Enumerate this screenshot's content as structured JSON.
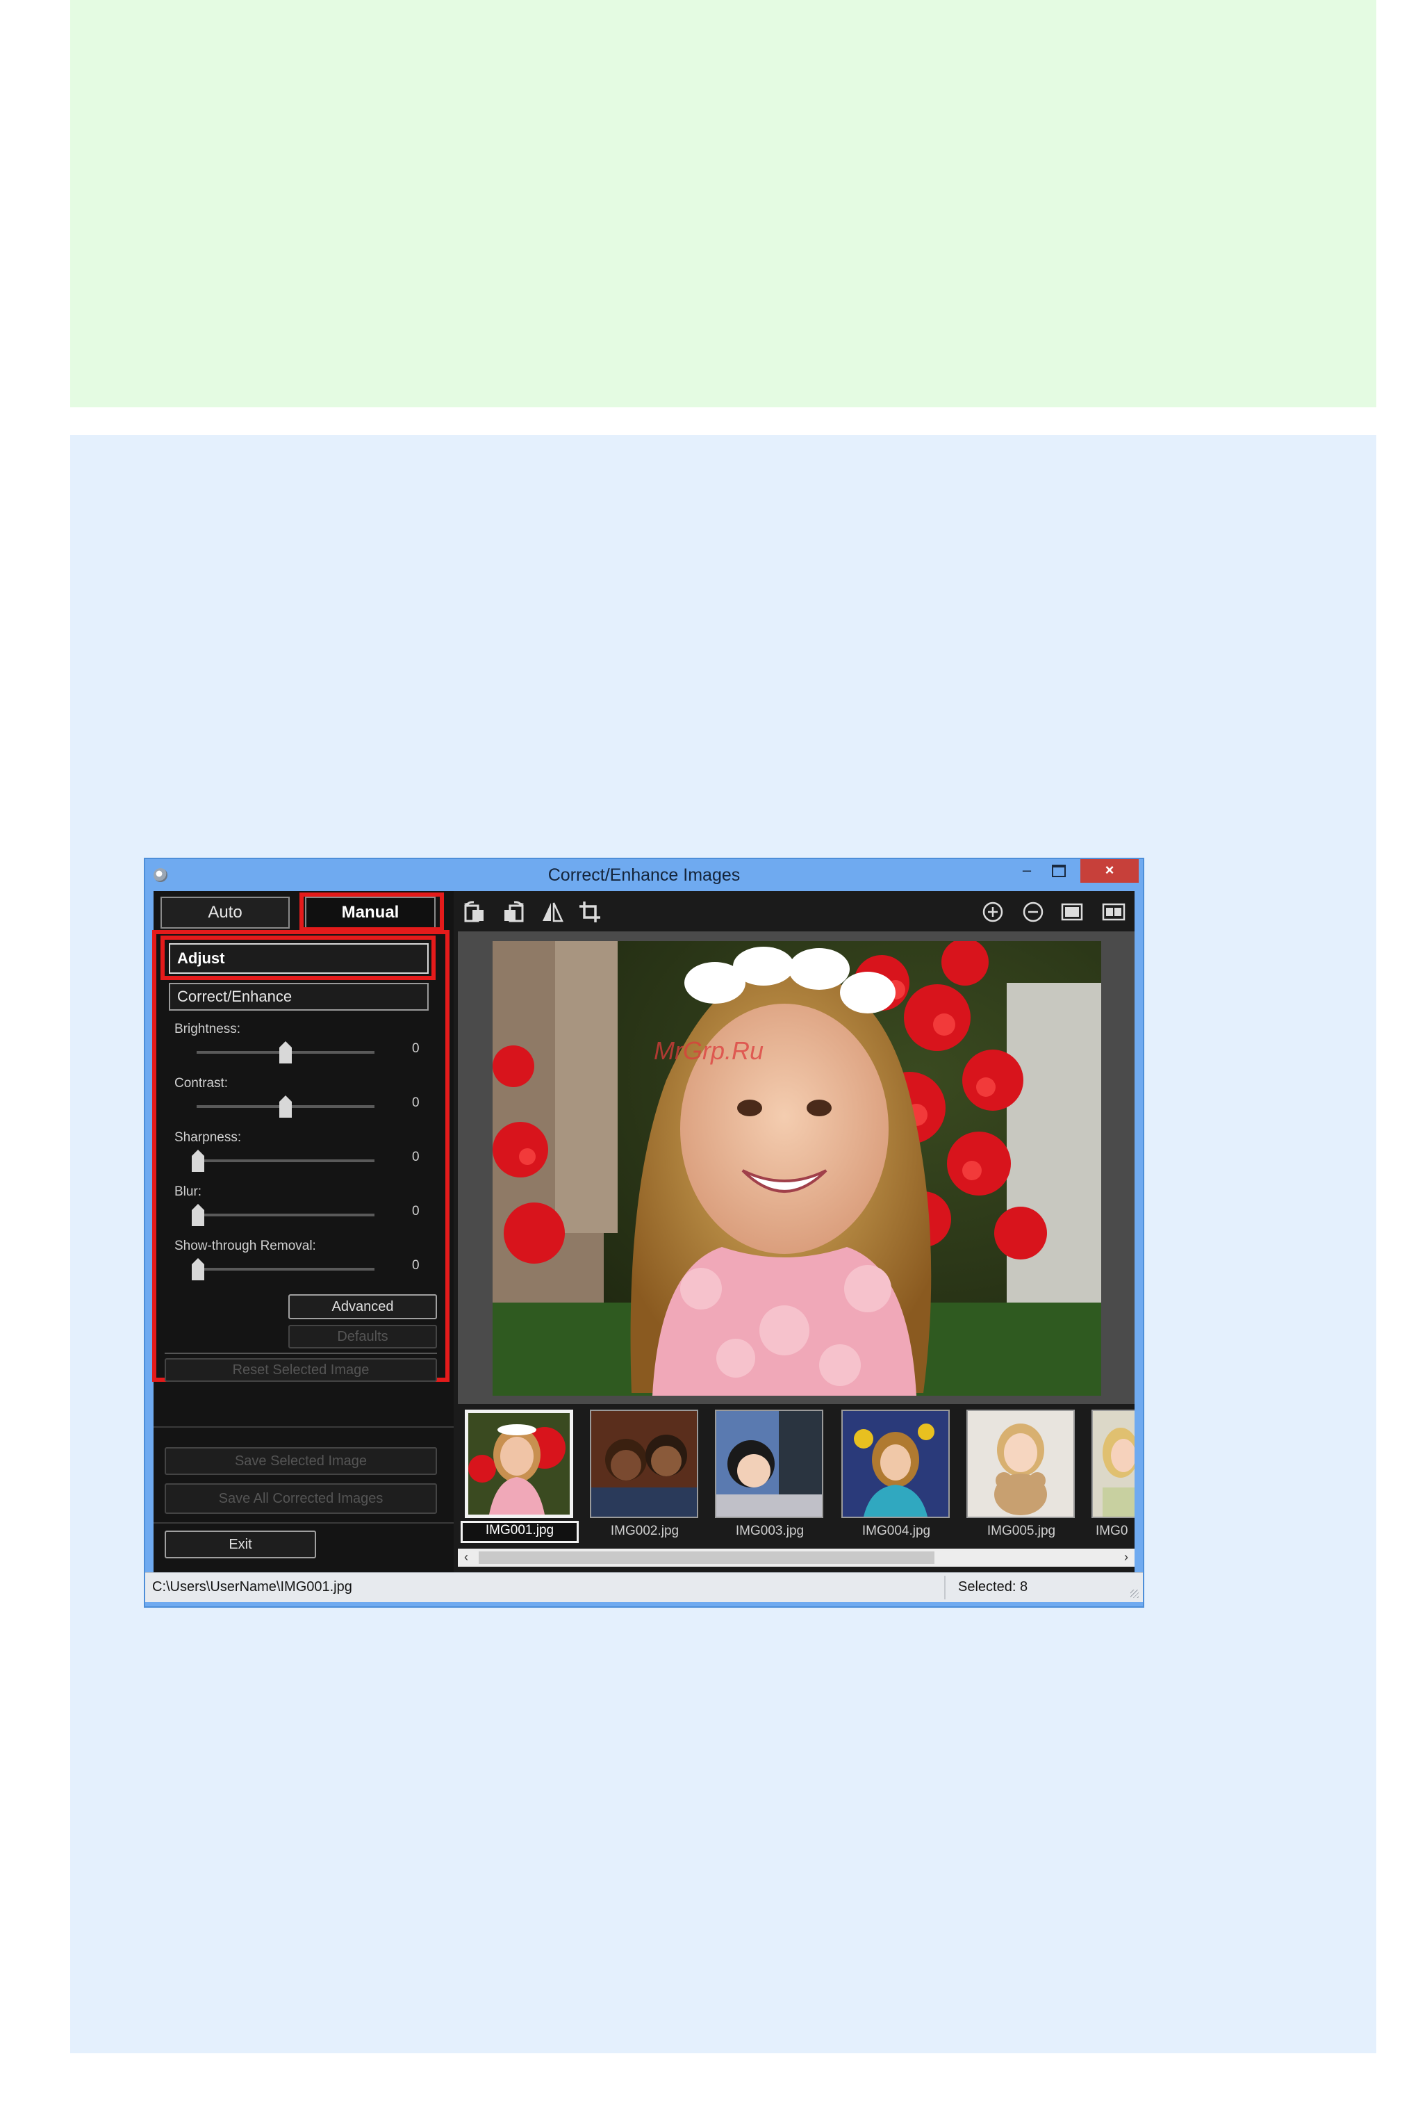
{
  "window": {
    "title": "Correct/Enhance Images",
    "controls": {
      "minimize": "–",
      "close": "×"
    }
  },
  "tabs": {
    "auto": "Auto",
    "manual": "Manual"
  },
  "left_panel": {
    "adjust_label": "Adjust",
    "correct_enhance_label": "Correct/Enhance",
    "sliders": [
      {
        "label": "Brightness:",
        "value": "0",
        "level": 0.5
      },
      {
        "label": "Contrast:",
        "value": "0",
        "level": 0.5
      },
      {
        "label": "Sharpness:",
        "value": "0",
        "level": 0.0
      },
      {
        "label": "Blur:",
        "value": "0",
        "level": 0.0
      },
      {
        "label": "Show-through Removal:",
        "value": "0",
        "level": 0.0
      }
    ],
    "advanced_button": "Advanced",
    "defaults_button": "Defaults",
    "reset_button": "Reset Selected Image",
    "save_selected_button": "Save Selected Image",
    "save_all_button": "Save All Corrected Images",
    "exit_button": "Exit"
  },
  "toolbar": {
    "left_icons": [
      "rotate-left-icon",
      "rotate-right-icon",
      "flip-icon",
      "crop-icon"
    ],
    "right_icons": [
      "zoom-in-icon",
      "zoom-out-icon",
      "full-screen-icon",
      "compare-icon"
    ]
  },
  "preview": {
    "watermark": "MrGrp.Ru"
  },
  "filmstrip": {
    "thumbnails": [
      "IMG001.jpg",
      "IMG002.jpg",
      "IMG003.jpg",
      "IMG004.jpg",
      "IMG005.jpg",
      "IMG0"
    ],
    "selected_index": 0
  },
  "status": {
    "path": "C:\\Users\\UserName\\IMG001.jpg",
    "selected": "Selected: 8"
  },
  "colors": {
    "highlight": "#e41b1b",
    "window_frame": "#6faaf0",
    "green_box": "#e4fbe2",
    "blue_box": "#e4f0fd"
  }
}
